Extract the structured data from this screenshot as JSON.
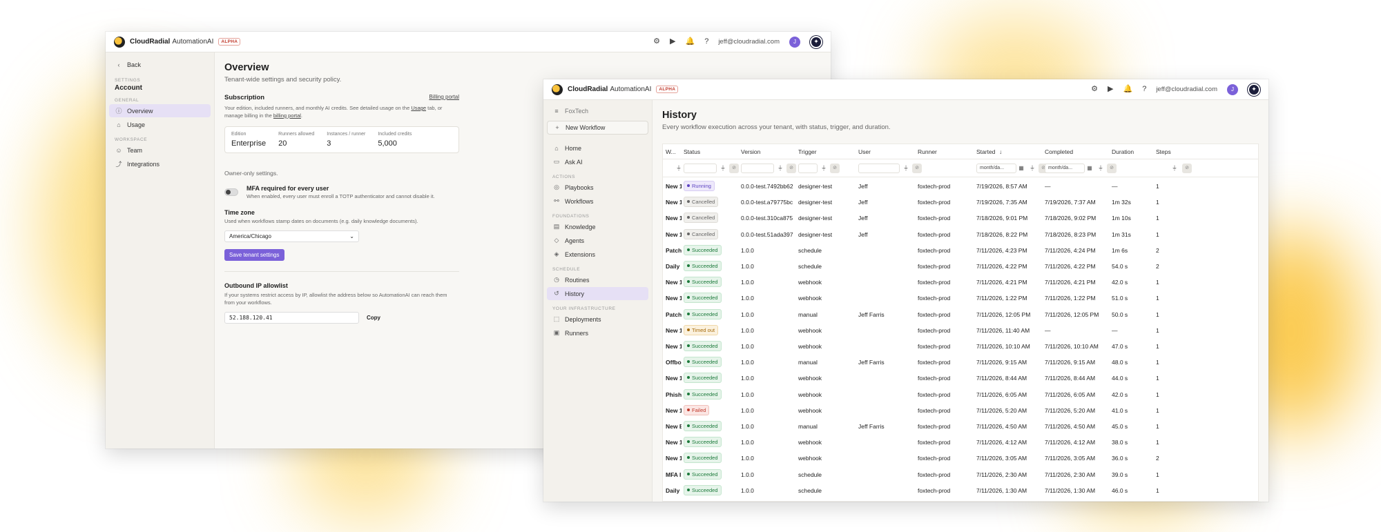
{
  "colors": {
    "accent": "#7b61d9",
    "success": "#1c7a3b",
    "failed": "#c0392b",
    "warning": "#a66b0b"
  },
  "app": {
    "brand": "CloudRadial",
    "product": "AutomationAI",
    "badge": "ALPHA",
    "user_email": "jeff@cloudradial.com",
    "user_initial": "J"
  },
  "settings_window": {
    "back_label": "Back",
    "settings_label": "SETTINGS",
    "account_label": "Account",
    "nav": [
      {
        "section": "GENERAL"
      },
      {
        "label": "Overview",
        "icon": "info-icon",
        "active": true
      },
      {
        "label": "Usage",
        "icon": "home-icon"
      },
      {
        "section": "WORKSPACE"
      },
      {
        "label": "Team",
        "icon": "users-icon"
      },
      {
        "label": "Integrations",
        "icon": "link-icon"
      }
    ],
    "title": "Overview",
    "subtitle": "Tenant-wide settings and security policy.",
    "subscription": {
      "title": "Subscription",
      "billing_link": "Billing portal",
      "desc_1": "Your edition, included runners, and monthly AI credits. See detailed usage on the",
      "desc_usage": "Usage",
      "desc_2": "tab, or",
      "desc_3": "manage billing in the",
      "desc_billing": "billing portal",
      "desc_4": ".",
      "fields": [
        {
          "label": "Edition",
          "value": "Enterprise"
        },
        {
          "label": "Runners allowed",
          "value": "20"
        },
        {
          "label": "Instances / runner",
          "value": "3"
        },
        {
          "label": "Included credits",
          "value": "5,000"
        }
      ]
    },
    "owner_only": "Owner-only settings.",
    "mfa": {
      "title": "MFA required for every user",
      "desc": "When enabled, every user must enroll a TOTP authenticator and cannot disable it."
    },
    "timezone": {
      "title": "Time zone",
      "desc": "Used when workflows stamp dates on documents (e.g. daily knowledge documents).",
      "value": "America/Chicago"
    },
    "save_button": "Save tenant settings",
    "outbound": {
      "title": "Outbound IP allowlist",
      "desc_1": "If your systems restrict access by IP, allowlist the address below so AutomationAI can reach them",
      "desc_2": "from your workflows.",
      "ip": "52.188.120.41",
      "copy": "Copy"
    }
  },
  "history_window": {
    "tenant": "FoxTech",
    "new_workflow": "New Workflow",
    "nav": [
      {
        "label": "Home",
        "icon": "home-icon"
      },
      {
        "label": "Ask AI",
        "icon": "chat-icon"
      },
      {
        "section": "ACTIONS"
      },
      {
        "label": "Playbooks",
        "icon": "playbook-icon"
      },
      {
        "label": "Workflows",
        "icon": "workflow-icon"
      },
      {
        "section": "FOUNDATIONS"
      },
      {
        "label": "Knowledge",
        "icon": "book-icon"
      },
      {
        "label": "Agents",
        "icon": "agent-icon"
      },
      {
        "label": "Extensions",
        "icon": "puzzle-icon"
      },
      {
        "section": "SCHEDULE"
      },
      {
        "label": "Routines",
        "icon": "clock-icon"
      },
      {
        "label": "History",
        "icon": "history-icon",
        "active": true
      },
      {
        "section": "YOUR INFRASTRUCTURE"
      },
      {
        "label": "Deployments",
        "icon": "deploy-icon"
      },
      {
        "label": "Runners",
        "icon": "runner-icon"
      }
    ],
    "title": "History",
    "subtitle": "Every workflow execution across your tenant, with status, trigger, and duration.",
    "columns": [
      "W...",
      "Status",
      "Version",
      "Trigger",
      "User",
      "Runner",
      "Started",
      "Completed",
      "Duration",
      "Steps"
    ],
    "date_placeholder": "month/da...",
    "rows": [
      [
        "New 1",
        "Running",
        "0.0.0-test.7492bb62",
        "designer-test",
        "Jeff",
        "foxtech-prod",
        "7/19/2026, 8:57 AM",
        "—",
        "—",
        "1"
      ],
      [
        "New 1",
        "Cancelled",
        "0.0.0-test.a79775bc",
        "designer-test",
        "Jeff",
        "foxtech-prod",
        "7/19/2026, 7:35 AM",
        "7/19/2026, 7:37 AM",
        "1m 32s",
        "1"
      ],
      [
        "New 1",
        "Cancelled",
        "0.0.0-test.310ca875",
        "designer-test",
        "Jeff",
        "foxtech-prod",
        "7/18/2026, 9:01 PM",
        "7/18/2026, 9:02 PM",
        "1m 10s",
        "1"
      ],
      [
        "New 1",
        "Cancelled",
        "0.0.0-test.51ada397",
        "designer-test",
        "Jeff",
        "foxtech-prod",
        "7/18/2026, 8:22 PM",
        "7/18/2026, 8:23 PM",
        "1m 31s",
        "1"
      ],
      [
        "Patch",
        "Succeeded",
        "1.0.0",
        "schedule",
        "",
        "foxtech-prod",
        "7/11/2026, 4:23 PM",
        "7/11/2026, 4:24 PM",
        "1m 6s",
        "2"
      ],
      [
        "Daily",
        "Succeeded",
        "1.0.0",
        "schedule",
        "",
        "foxtech-prod",
        "7/11/2026, 4:22 PM",
        "7/11/2026, 4:22 PM",
        "54.0 s",
        "2"
      ],
      [
        "New 1",
        "Succeeded",
        "1.0.0",
        "webhook",
        "",
        "foxtech-prod",
        "7/11/2026, 4:21 PM",
        "7/11/2026, 4:21 PM",
        "42.0 s",
        "1"
      ],
      [
        "New 1",
        "Succeeded",
        "1.0.0",
        "webhook",
        "",
        "foxtech-prod",
        "7/11/2026, 1:22 PM",
        "7/11/2026, 1:22 PM",
        "51.0 s",
        "1"
      ],
      [
        "Patch",
        "Succeeded",
        "1.0.0",
        "manual",
        "Jeff Farris",
        "foxtech-prod",
        "7/11/2026, 12:05 PM",
        "7/11/2026, 12:05 PM",
        "50.0 s",
        "1"
      ],
      [
        "New 1",
        "Timed out",
        "1.0.0",
        "webhook",
        "",
        "foxtech-prod",
        "7/11/2026, 11:40 AM",
        "—",
        "—",
        "1"
      ],
      [
        "New 1",
        "Succeeded",
        "1.0.0",
        "webhook",
        "",
        "foxtech-prod",
        "7/11/2026, 10:10 AM",
        "7/11/2026, 10:10 AM",
        "47.0 s",
        "1"
      ],
      [
        "Offbo",
        "Succeeded",
        "1.0.0",
        "manual",
        "Jeff Farris",
        "foxtech-prod",
        "7/11/2026, 9:15 AM",
        "7/11/2026, 9:15 AM",
        "48.0 s",
        "1"
      ],
      [
        "New 1",
        "Succeeded",
        "1.0.0",
        "webhook",
        "",
        "foxtech-prod",
        "7/11/2026, 8:44 AM",
        "7/11/2026, 8:44 AM",
        "44.0 s",
        "1"
      ],
      [
        "Phish",
        "Succeeded",
        "1.0.0",
        "webhook",
        "",
        "foxtech-prod",
        "7/11/2026, 6:05 AM",
        "7/11/2026, 6:05 AM",
        "42.0 s",
        "1"
      ],
      [
        "New 1",
        "Failed",
        "1.0.0",
        "webhook",
        "",
        "foxtech-prod",
        "7/11/2026, 5:20 AM",
        "7/11/2026, 5:20 AM",
        "41.0 s",
        "1"
      ],
      [
        "New E",
        "Succeeded",
        "1.0.0",
        "manual",
        "Jeff Farris",
        "foxtech-prod",
        "7/11/2026, 4:50 AM",
        "7/11/2026, 4:50 AM",
        "45.0 s",
        "1"
      ],
      [
        "New 1",
        "Succeeded",
        "1.0.0",
        "webhook",
        "",
        "foxtech-prod",
        "7/11/2026, 4:12 AM",
        "7/11/2026, 4:12 AM",
        "38.0 s",
        "1"
      ],
      [
        "New 1",
        "Succeeded",
        "1.0.0",
        "webhook",
        "",
        "foxtech-prod",
        "7/11/2026, 3:05 AM",
        "7/11/2026, 3:05 AM",
        "36.0 s",
        "2"
      ],
      [
        "MFA I",
        "Succeeded",
        "1.0.0",
        "schedule",
        "",
        "foxtech-prod",
        "7/11/2026, 2:30 AM",
        "7/11/2026, 2:30 AM",
        "39.0 s",
        "1"
      ],
      [
        "Daily",
        "Succeeded",
        "1.0.0",
        "schedule",
        "",
        "foxtech-prod",
        "7/11/2026, 1:30 AM",
        "7/11/2026, 1:30 AM",
        "46.0 s",
        "1"
      ]
    ]
  }
}
